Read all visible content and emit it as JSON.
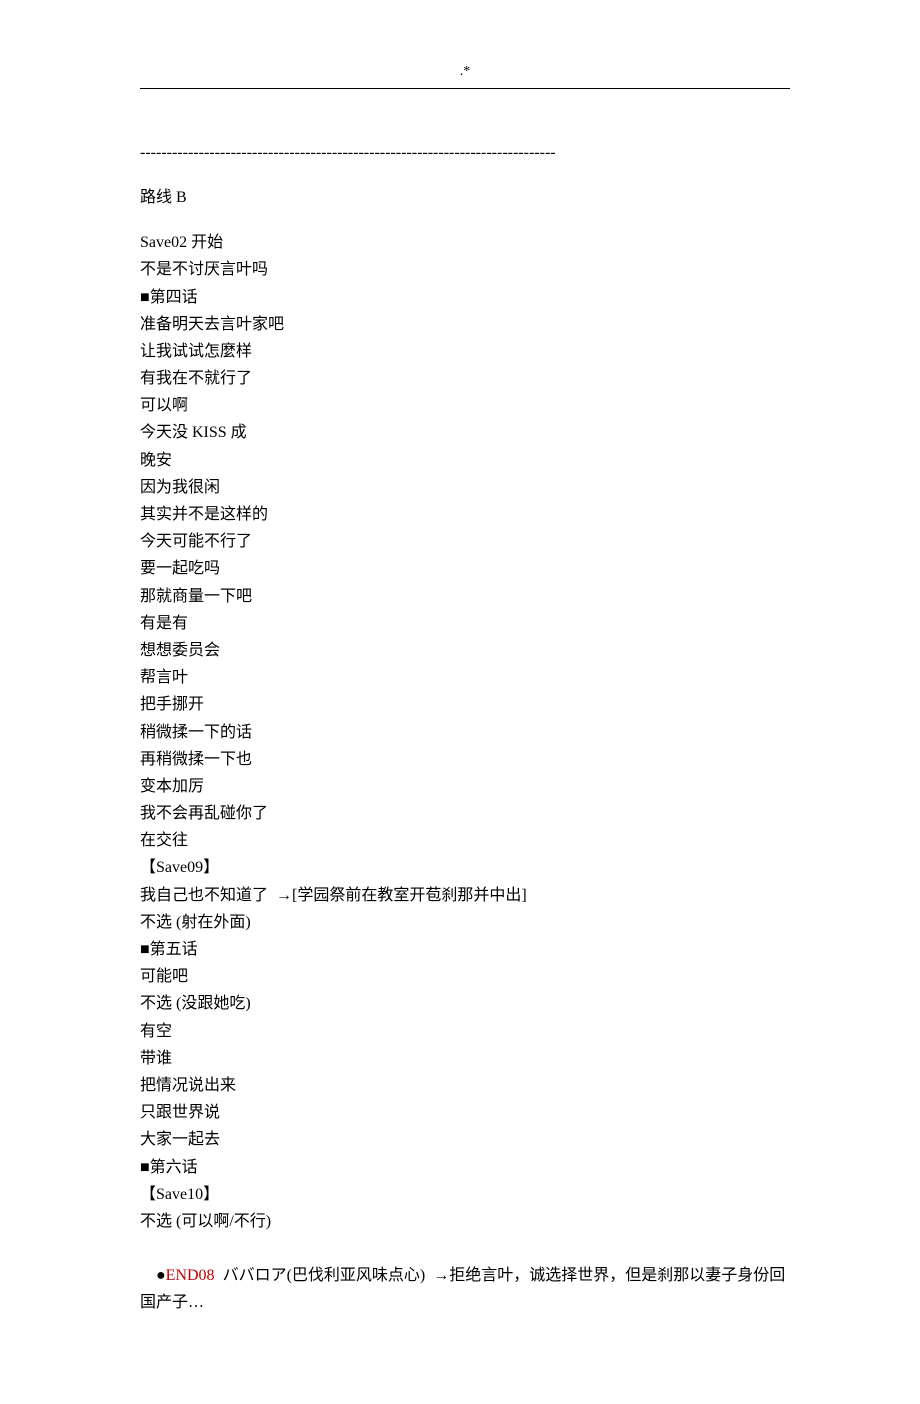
{
  "header_mark": ".*",
  "separator": "------------------------------------------------------------------------------",
  "route_title": "路线 B",
  "lines": [
    "Save02 开始",
    "不是不讨厌言叶吗",
    "■第四话",
    "准备明天去言叶家吧",
    "让我试试怎麼样",
    "有我在不就行了",
    "可以啊",
    "今天没 KISS 成",
    "晚安",
    "因为我很闲",
    "其实并不是这样的",
    "今天可能不行了",
    "要一起吃吗",
    "那就商量一下吧",
    "有是有",
    "想想委员会",
    "帮言叶",
    "把手挪开",
    "稍微揉一下的话",
    "再稍微揉一下也",
    "变本加厉",
    "我不会再乱碰你了",
    "在交往",
    "【Save09】",
    "我自己也不知道了  →[学园祭前在教室开苞刹那并中出]",
    "不选 (射在外面)",
    "■第五话",
    "可能吧",
    "不选 (没跟她吃)",
    "有空",
    "带谁",
    "把情况说出来",
    "只跟世界说",
    "大家一起去",
    "■第六话",
    "【Save10】",
    "不选 (可以啊/不行)"
  ],
  "end_bullet": "●",
  "end_code": "END08",
  "end_text": "  ババロア(巴伐利亚风味点心)  →拒绝言叶，诚选择世界，但是刹那以妻子身份回国产子…"
}
